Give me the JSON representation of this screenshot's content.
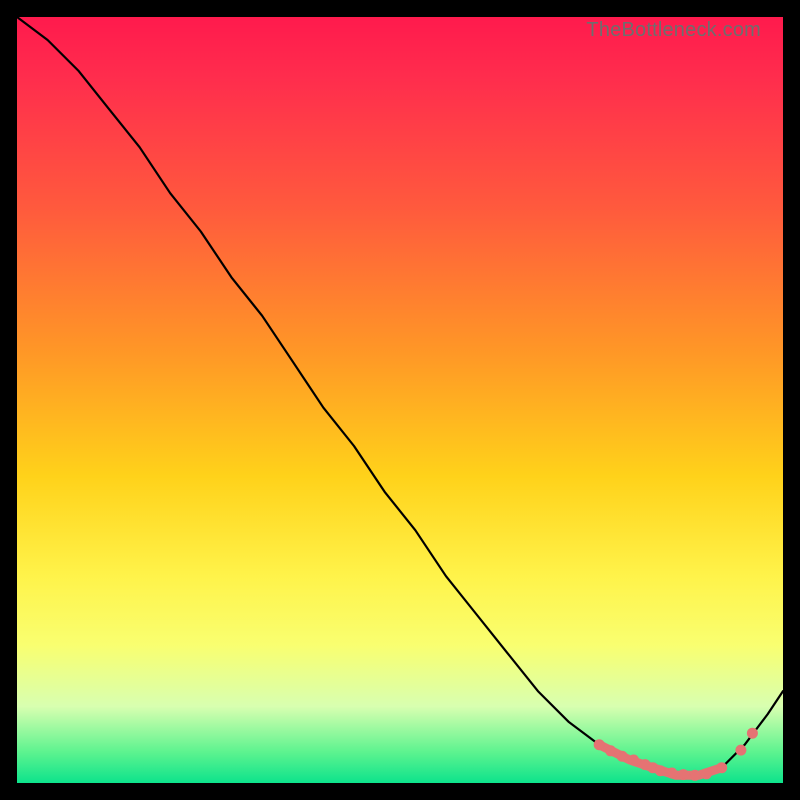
{
  "watermark": "TheBottleneck.com",
  "chart_data": {
    "type": "line",
    "title": "",
    "xlabel": "",
    "ylabel": "",
    "xlim": [
      0,
      100
    ],
    "ylim": [
      0,
      100
    ],
    "grid": false,
    "legend": false,
    "x": [
      0,
      4,
      8,
      12,
      16,
      20,
      24,
      28,
      32,
      36,
      40,
      44,
      48,
      52,
      56,
      60,
      64,
      68,
      72,
      76,
      80,
      83,
      86,
      89,
      92,
      95,
      98,
      100
    ],
    "y": [
      100,
      97,
      93,
      88,
      83,
      77,
      72,
      66,
      61,
      55,
      49,
      44,
      38,
      33,
      27,
      22,
      17,
      12,
      8,
      5,
      3,
      2,
      1,
      1,
      2,
      5,
      9,
      12
    ],
    "highlight_segment_x": [
      76,
      92
    ],
    "markers_x": [
      76,
      77.5,
      79,
      80.5,
      82,
      83,
      84,
      85.5,
      87,
      88.5,
      90,
      92,
      94.5,
      96
    ],
    "markers_y": [
      5,
      4.2,
      3.5,
      3,
      2.4,
      2,
      1.6,
      1.3,
      1.1,
      1,
      1.2,
      2,
      4.3,
      6.5
    ]
  }
}
